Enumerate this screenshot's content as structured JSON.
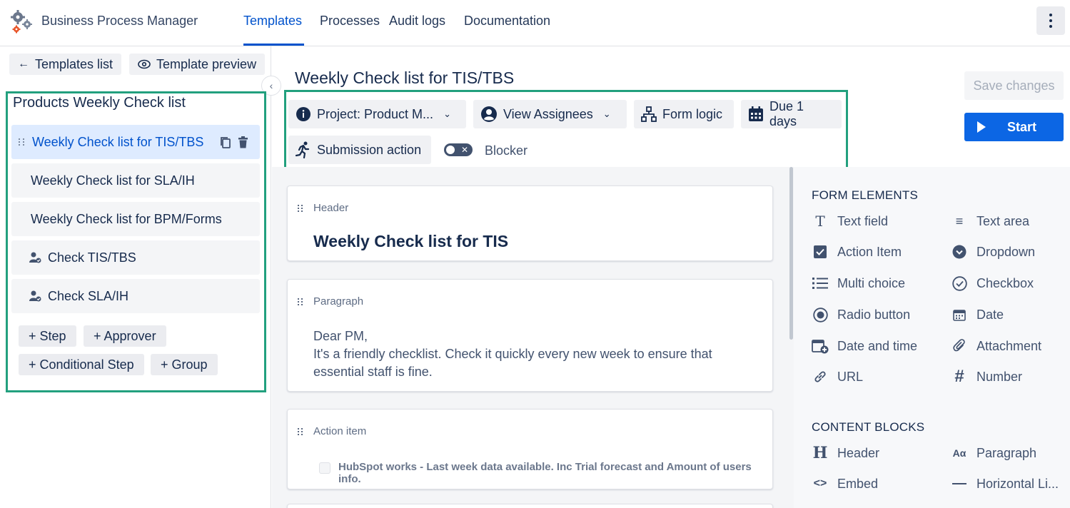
{
  "app": {
    "title": "Business Process Manager"
  },
  "nav": {
    "tabs": [
      {
        "label": "Templates",
        "active": true
      },
      {
        "label": "Processes"
      },
      {
        "label": "Audit logs"
      },
      {
        "label": "Documentation"
      }
    ]
  },
  "sidebar": {
    "back_label": "Templates list",
    "preview_label": "Template preview",
    "title": "Products Weekly Check list",
    "steps": [
      {
        "label": "Weekly Check list for TIS/TBS",
        "active": true
      },
      {
        "label": "Weekly Check list for SLA/IH"
      },
      {
        "label": "Weekly Check list for BPM/Forms"
      },
      {
        "label": "Check TIS/TBS",
        "icon": "user-check-icon"
      },
      {
        "label": "Check SLA/IH",
        "icon": "user-check-icon"
      }
    ],
    "add_buttons": {
      "step": "+ Step",
      "approver": "+ Approver",
      "conditional": "+ Conditional Step",
      "group": "+ Group"
    }
  },
  "main": {
    "title": "Weekly Check list for TIS/TBS",
    "chips": {
      "project": "Project: Product M...",
      "assignees": "View Assignees",
      "form_logic": "Form logic",
      "due": "Due 1 days",
      "submission": "Submission action"
    },
    "blocker_label": "Blocker",
    "blocker_on": false,
    "save_label": "Save changes",
    "start_label": "Start"
  },
  "cards": [
    {
      "type_label": "Header",
      "heading": "Weekly Check list for TIS"
    },
    {
      "type_label": "Paragraph",
      "text": "Dear PM,\nIt's a friendly checklist. Check it quickly every new week to ensure that essential staff is fine."
    },
    {
      "type_label": "Action item",
      "text": "HubSpot works - Last week data available. Inc Trial forecast and Amount of users info."
    }
  ],
  "right_panel": {
    "form_elements_title": "FORM ELEMENTS",
    "form_elements": [
      {
        "label": "Text field",
        "icon": "text-field-icon"
      },
      {
        "label": "Text area",
        "icon": "text-area-icon"
      },
      {
        "label": "Action Item",
        "icon": "checkbox-checked-icon"
      },
      {
        "label": "Dropdown",
        "icon": "dropdown-icon"
      },
      {
        "label": "Multi choice",
        "icon": "list-icon"
      },
      {
        "label": "Checkbox",
        "icon": "check-circle-icon"
      },
      {
        "label": "Radio button",
        "icon": "radio-icon"
      },
      {
        "label": "Date",
        "icon": "calendar-icon"
      },
      {
        "label": "Date and time",
        "icon": "calendar-add-icon"
      },
      {
        "label": "Attachment",
        "icon": "paperclip-icon"
      },
      {
        "label": "URL",
        "icon": "link-icon"
      },
      {
        "label": "Number",
        "icon": "hash-icon"
      }
    ],
    "content_blocks_title": "CONTENT BLOCKS",
    "content_blocks": [
      {
        "label": "Header",
        "icon": "heading-icon"
      },
      {
        "label": "Paragraph",
        "icon": "paragraph-icon"
      },
      {
        "label": "Embed",
        "icon": "code-icon"
      },
      {
        "label": "Horizontal Li...",
        "icon": "horizontal-line-icon"
      }
    ]
  },
  "colors": {
    "accent": "#0052cc",
    "highlight": "#22a07e",
    "start": "#0c66e4"
  }
}
